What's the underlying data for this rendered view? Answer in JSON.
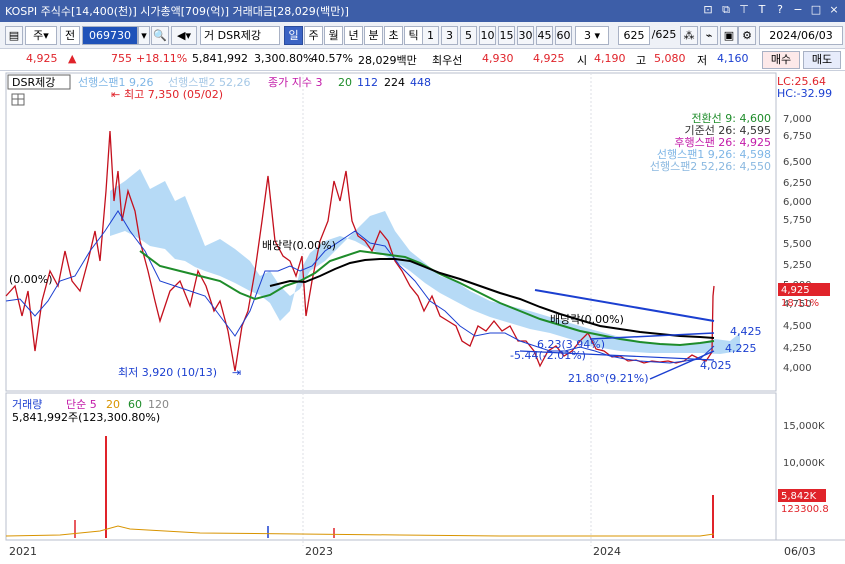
{
  "title": "KOSPI 주식수[14,400(천)] 시가총액[709(억)] 거래대금[28,029(백만)]",
  "window_buttons": [
    "⊡",
    "⧉",
    "⊤",
    "T",
    "?",
    "−",
    "□",
    "×"
  ],
  "toolbar": {
    "type": "주",
    "mode": "전",
    "code": "069730",
    "name": "DSR제강",
    "name_prefix": "거",
    "periods": [
      "일",
      "주",
      "월",
      "년",
      "분",
      "초",
      "틱"
    ],
    "selected_period": "일",
    "minutes": [
      "1",
      "3",
      "5",
      "10",
      "15",
      "30",
      "45",
      "60"
    ],
    "interval": "3",
    "count": "625",
    "count_total": "/625",
    "date": "2024/06/03"
  },
  "quote": {
    "price": "4,925",
    "arrow": "▲",
    "change": "755",
    "change_pct": "+18.11%",
    "volume": "5,841,992",
    "vol_pct": "3,300.80%",
    "turnover_pct": "40.57%",
    "amount": "28,029백만",
    "best": "최우선",
    "ask": "4,930",
    "bid": "4,925",
    "open_label": "시",
    "open": "4,190",
    "high_label": "고",
    "high": "5,080",
    "low_label": "저",
    "low": "4,160",
    "buy_btn": "매수",
    "sell_btn": "매도"
  },
  "legend": {
    "name": "DSR제강",
    "span1": "선행스팬1 9,26",
    "span2": "선행스팬2 52,26",
    "ma_label": "종가 지수 3",
    "ma20": "20",
    "ma112": "112",
    "ma224": "224",
    "ma448": "448",
    "lc": "LC:25.64",
    "hc": "HC:-32.99"
  },
  "ichimoku": {
    "conversion": "전환선 9: 4,600",
    "base": "기준선 26: 4,595",
    "lagging": "후행스팬 26: 4,925",
    "span1": "선행스팬1 9,26: 4,598",
    "span2": "선행스팬2 52,26: 4,550"
  },
  "annotations": {
    "high": "최고 7,350 (05/02)",
    "low": "최저 3,920 (10/13)",
    "div1": "배당락(0.00%)",
    "div2": "(0.00%)",
    "div3": "배당락(0.00%)",
    "t1": "4,425",
    "t2": "4,225",
    "t3": "4,025",
    "pct1": "6.23(3.94%)",
    "pct2": "-5.44(-2.01%)",
    "pct3": "21.80°(9.21%)"
  },
  "price_axis": {
    "ticks": [
      "7,000",
      "6,750",
      "6,500",
      "6,250",
      "6,000",
      "5,750",
      "5,500",
      "5,250",
      "5,000",
      "4,750",
      "4,500",
      "4,250",
      "4,000"
    ],
    "current": "4,925",
    "current_pct": "18.11%"
  },
  "volume": {
    "legend_name": "거래량",
    "legend_ma": "단순 5",
    "ma20": "20",
    "ma60": "60",
    "ma120": "120",
    "value": "5,841,992주(123,300.80%)",
    "ticks": [
      "15,000K",
      "10,000K"
    ],
    "current": "5,842K",
    "current_pct": "123300.8"
  },
  "x_axis": {
    "labels": [
      "2021",
      "2023",
      "2024",
      "06/03"
    ]
  },
  "colors": {
    "title_bg": "#3d5ea8",
    "up": "#e0232a",
    "down": "#1b3fd0",
    "cloud": "#a9d3f5",
    "ma20": "#1e8c2a",
    "ma112": "#000000"
  }
}
